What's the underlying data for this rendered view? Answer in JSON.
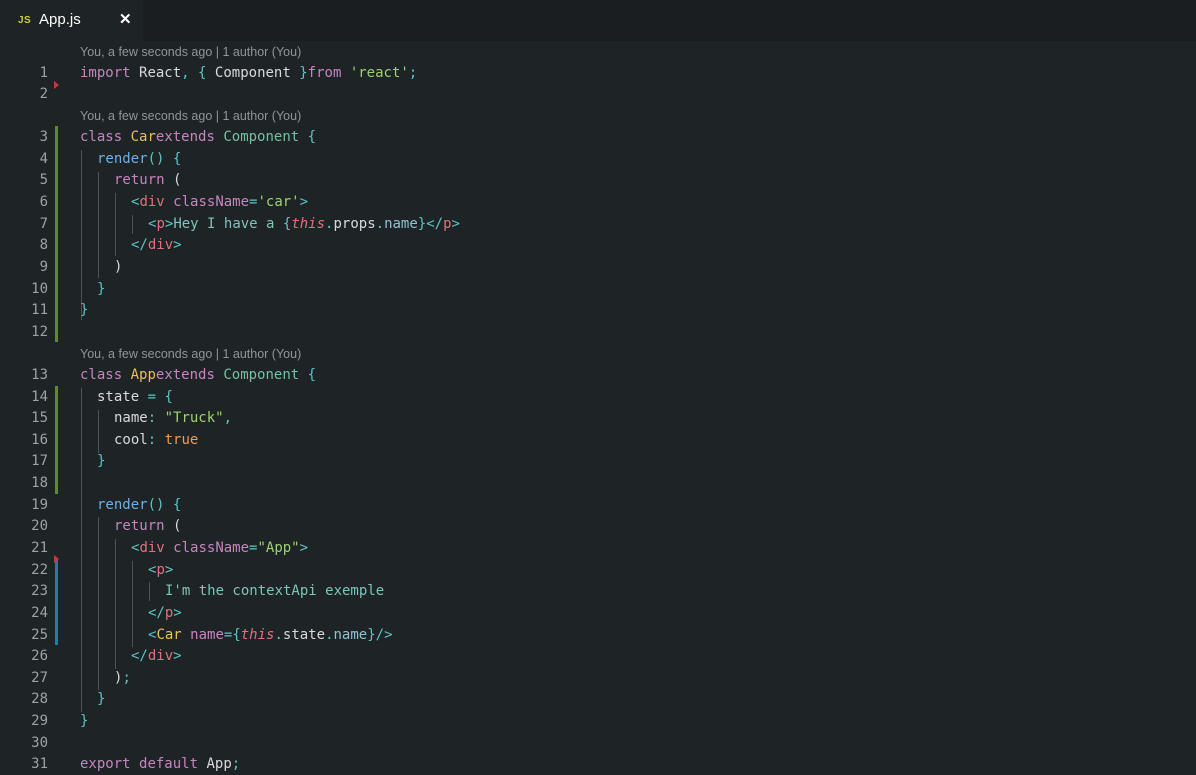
{
  "tab": {
    "icon": "JS",
    "title": "App.js",
    "close": "✕"
  },
  "lenses": [
    "You, a few seconds ago | 1 author (You)",
    "You, a few seconds ago | 1 author (You)",
    "You, a few seconds ago | 1 author (You)"
  ],
  "lines": [
    {
      "n": "1",
      "t": [
        [
          "k",
          "import"
        ],
        [
          "",
          "React"
        ],
        [
          "p",
          ","
        ],
        [
          "p",
          "{"
        ],
        [
          "",
          "Component"
        ],
        [
          "p",
          "}"
        ],
        [
          "k",
          "from"
        ],
        [
          "s",
          "'react'"
        ],
        [
          "p",
          ";"
        ]
      ]
    },
    {
      "n": "2",
      "t": []
    },
    {
      "n": "3",
      "t": [
        [
          "k",
          "class"
        ],
        [
          "cls",
          "Car"
        ],
        [
          "k",
          "extends"
        ],
        [
          "t",
          "Component"
        ],
        [
          "p",
          "{"
        ]
      ]
    },
    {
      "n": "4",
      "t": [
        [
          "fn",
          "render"
        ],
        [
          "p",
          "()"
        ],
        [
          "p",
          "{"
        ]
      ]
    },
    {
      "n": "5",
      "t": [
        [
          "k",
          "return"
        ],
        [
          "",
          "("
        ]
      ]
    },
    {
      "n": "6",
      "t": [
        [
          "p",
          "<"
        ],
        [
          "tag",
          "div"
        ],
        [
          "attr",
          "className"
        ],
        [
          "p",
          "="
        ],
        [
          "s",
          "'car'"
        ],
        [
          "p",
          ">"
        ]
      ]
    },
    {
      "n": "7",
      "t": [
        [
          "p",
          "<"
        ],
        [
          "tag",
          "p"
        ],
        [
          "p",
          ">"
        ],
        [
          "txt",
          "Hey I have a "
        ],
        [
          "p",
          "{"
        ],
        [
          "th",
          "this"
        ],
        [
          "p",
          "."
        ],
        [
          "",
          "props"
        ],
        [
          "p",
          "."
        ],
        [
          "nm",
          "name"
        ],
        [
          "p",
          "}</"
        ],
        [
          "tag",
          "p"
        ],
        [
          "p",
          ">"
        ]
      ]
    },
    {
      "n": "8",
      "t": [
        [
          "p",
          "</"
        ],
        [
          "tag",
          "div"
        ],
        [
          "p",
          ">"
        ]
      ]
    },
    {
      "n": "9",
      "t": [
        [
          "",
          ")"
        ]
      ]
    },
    {
      "n": "10",
      "t": [
        [
          "p",
          "}"
        ]
      ]
    },
    {
      "n": "11",
      "t": [
        [
          "p",
          "}"
        ]
      ]
    },
    {
      "n": "12",
      "t": []
    },
    {
      "n": "13",
      "t": [
        [
          "k",
          "class"
        ],
        [
          "cls",
          "App"
        ],
        [
          "k",
          "extends"
        ],
        [
          "t",
          "Component"
        ],
        [
          "p",
          "{"
        ]
      ]
    },
    {
      "n": "14",
      "t": [
        [
          "",
          "state"
        ],
        [
          "p",
          "="
        ],
        [
          "p",
          "{"
        ]
      ]
    },
    {
      "n": "15",
      "t": [
        [
          "",
          "name"
        ],
        [
          "p",
          ":"
        ],
        [
          "s",
          "\"Truck\""
        ],
        [
          "p",
          ","
        ]
      ]
    },
    {
      "n": "16",
      "t": [
        [
          "",
          "cool"
        ],
        [
          "p",
          ":"
        ],
        [
          "bool",
          "true"
        ]
      ]
    },
    {
      "n": "17",
      "t": [
        [
          "p",
          "}"
        ]
      ]
    },
    {
      "n": "18",
      "t": []
    },
    {
      "n": "19",
      "t": [
        [
          "fn",
          "render"
        ],
        [
          "p",
          "()"
        ],
        [
          "p",
          "{"
        ]
      ]
    },
    {
      "n": "20",
      "t": [
        [
          "k",
          "return"
        ],
        [
          "",
          "("
        ]
      ]
    },
    {
      "n": "21",
      "t": [
        [
          "p",
          "<"
        ],
        [
          "tag",
          "div"
        ],
        [
          "attr",
          "className"
        ],
        [
          "p",
          "="
        ],
        [
          "s",
          "\"App\""
        ],
        [
          "p",
          ">"
        ]
      ]
    },
    {
      "n": "22",
      "t": [
        [
          "p",
          "<"
        ],
        [
          "tag",
          "p"
        ],
        [
          "p",
          ">"
        ]
      ]
    },
    {
      "n": "23",
      "t": [
        [
          "txt",
          "I'm the contextApi exemple"
        ]
      ]
    },
    {
      "n": "24",
      "t": [
        [
          "p",
          "</"
        ],
        [
          "tag",
          "p"
        ],
        [
          "p",
          ">"
        ]
      ]
    },
    {
      "n": "25",
      "t": [
        [
          "p",
          "<"
        ],
        [
          "cls",
          "Car"
        ],
        [
          "attr",
          "name"
        ],
        [
          "p",
          "={"
        ],
        [
          "th",
          "this"
        ],
        [
          "p",
          "."
        ],
        [
          "",
          "state"
        ],
        [
          "p",
          "."
        ],
        [
          "nm",
          "name"
        ],
        [
          "p",
          "}/>"
        ]
      ]
    },
    {
      "n": "26",
      "t": [
        [
          "p",
          "</"
        ],
        [
          "tag",
          "div"
        ],
        [
          "p",
          ">"
        ]
      ]
    },
    {
      "n": "27",
      "t": [
        [
          "",
          ")"
        ],
        [
          "p",
          ";"
        ]
      ]
    },
    {
      "n": "28",
      "t": [
        [
          "p",
          "}"
        ]
      ]
    },
    {
      "n": "29",
      "t": [
        [
          "p",
          "}"
        ]
      ]
    },
    {
      "n": "30",
      "t": []
    },
    {
      "n": "31",
      "t": [
        [
          "k",
          "export"
        ],
        [
          "k",
          "default"
        ],
        [
          "",
          "App"
        ],
        [
          "p",
          ";"
        ]
      ]
    }
  ],
  "colors": {
    "background": "#1e2326",
    "gutter_added": "#5f8b22",
    "gutter_modified": "#1f7fa8",
    "gutter_deleted": "#c43a3a"
  }
}
